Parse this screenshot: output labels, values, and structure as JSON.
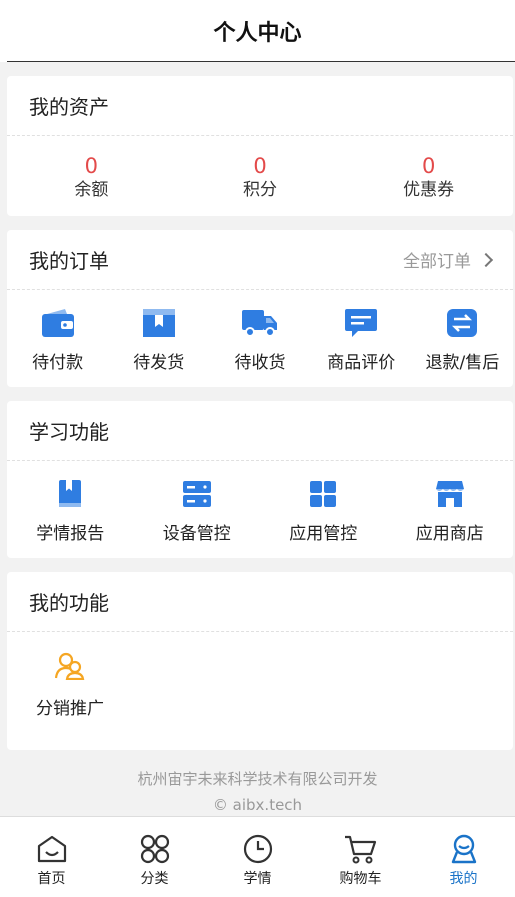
{
  "header": {
    "title": "个人中心"
  },
  "assets": {
    "title": "我的资产",
    "items": [
      {
        "value": "0",
        "label": "余额"
      },
      {
        "value": "0",
        "label": "积分"
      },
      {
        "value": "0",
        "label": "优惠券"
      }
    ]
  },
  "orders": {
    "title": "我的订单",
    "all_label": "全部订单",
    "items": [
      {
        "label": "待付款",
        "icon": "wallet-icon"
      },
      {
        "label": "待发货",
        "icon": "package-icon"
      },
      {
        "label": "待收货",
        "icon": "truck-icon"
      },
      {
        "label": "商品评价",
        "icon": "comment-icon"
      },
      {
        "label": "退款/售后",
        "icon": "exchange-icon"
      }
    ]
  },
  "study": {
    "title": "学习功能",
    "items": [
      {
        "label": "学情报告",
        "icon": "report-book-icon"
      },
      {
        "label": "设备管控",
        "icon": "server-icon"
      },
      {
        "label": "应用管控",
        "icon": "app-grid-icon"
      },
      {
        "label": "应用商店",
        "icon": "store-icon"
      }
    ]
  },
  "myfunc": {
    "title": "我的功能",
    "items": [
      {
        "label": "分销推广",
        "icon": "users-icon"
      }
    ]
  },
  "footer": {
    "company": "杭州宙宇未来科学技术有限公司开发",
    "site": "© aibx.tech"
  },
  "tabbar": {
    "items": [
      {
        "label": "首页",
        "icon": "home-icon"
      },
      {
        "label": "分类",
        "icon": "category-icon"
      },
      {
        "label": "学情",
        "icon": "clock-icon"
      },
      {
        "label": "购物车",
        "icon": "cart-icon"
      },
      {
        "label": "我的",
        "icon": "profile-icon",
        "active": true
      }
    ]
  },
  "colors": {
    "accent": "#1a73c8",
    "icon_blue": "#2f7de1",
    "value_red": "#e34a4a",
    "orange": "#f5a623"
  }
}
